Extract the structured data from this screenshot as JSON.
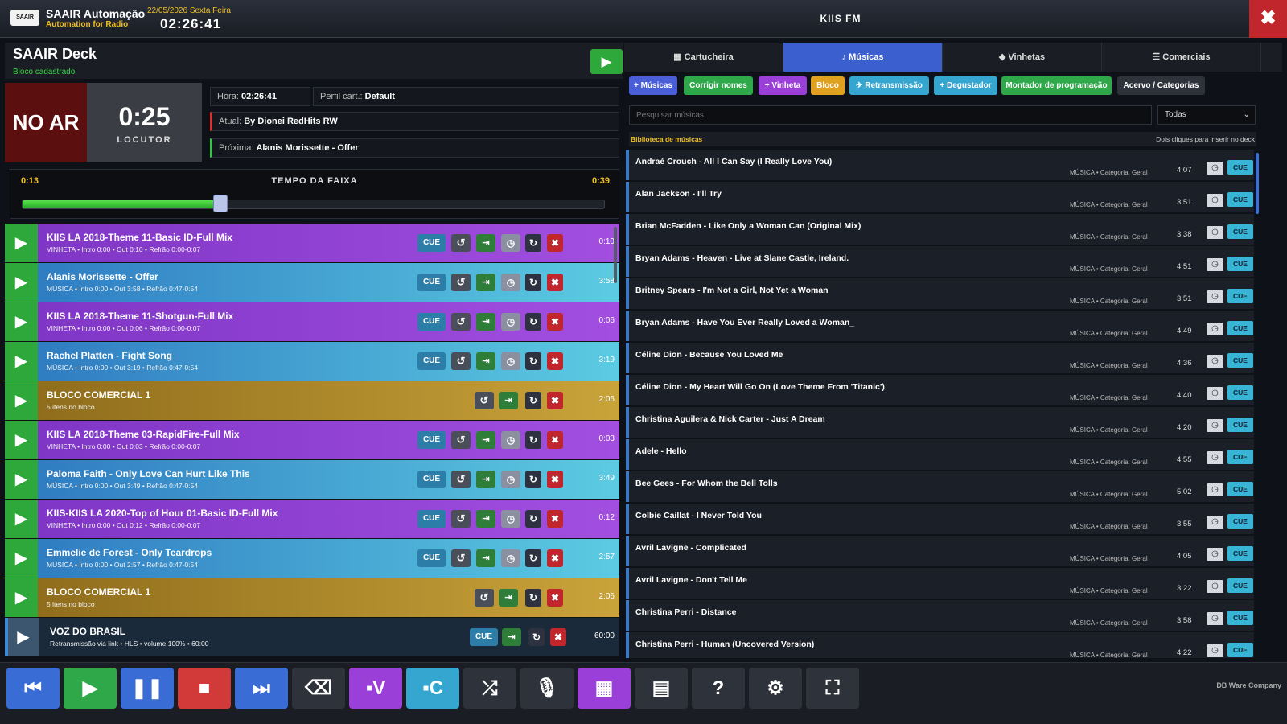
{
  "header": {
    "logo_text": "SAAIR",
    "app_name": "SAAIR Automação",
    "app_subtitle": "Automation for Radio",
    "date": "22/05/2026 Sexta Feira",
    "time": "02:26:41",
    "station": "KIIS FM",
    "close_icon": "✖"
  },
  "deck": {
    "title": "SAAIR Deck",
    "subtitle": "Bloco cadastrado",
    "play_icon": "▶",
    "onair": "NO AR",
    "countdown": "0:25",
    "countdown_label": "LOCUTOR",
    "hora_label": "Hora:",
    "hora": "02:26:41",
    "perfil_label": "Perfil cart.:",
    "perfil": "Default",
    "atual_label": "Atual:",
    "atual": "By Dionei RedHits RW",
    "proxima_label": "Próxima:",
    "proxima": "Alanis Morissette - Offer"
  },
  "track": {
    "elapsed": "0:13",
    "remaining": "0:39",
    "title": "TEMPO DA FAIXA",
    "progress": 0.34
  },
  "playlist": {
    "cue_label": "CUE",
    "icons": {
      "play": "▶",
      "replay": "↺",
      "next": "⇥",
      "clock": "◷",
      "repeat": "↻",
      "delete": "✖"
    },
    "rows": [
      {
        "type": "vinheta",
        "title": "KIIS LA 2018-Theme 11-Basic ID-Full Mix",
        "info": "VINHETA • Intro 0:00 • Out 0:10 • Refrão 0:00-0:07",
        "duration": "0:10"
      },
      {
        "type": "musica",
        "title": "Alanis Morissette - Offer",
        "info": "MÚSICA • Intro 0:00 • Out 3:58 • Refrão 0:47-0:54",
        "duration": "3:58"
      },
      {
        "type": "vinheta",
        "title": "KIIS LA 2018-Theme 11-Shotgun-Full Mix",
        "info": "VINHETA • Intro 0:00 • Out 0:06 • Refrão 0:00-0:07",
        "duration": "0:06"
      },
      {
        "type": "musica",
        "title": "Rachel Platten - Fight Song",
        "info": "MÚSICA • Intro 0:00 • Out 3:19 • Refrão 0:47-0:54",
        "duration": "3:19"
      },
      {
        "type": "bloco",
        "title": "BLOCO COMERCIAL 1",
        "info": "5 itens no bloco",
        "duration": "2:06"
      },
      {
        "type": "vinheta",
        "title": "KIIS LA 2018-Theme 03-RapidFire-Full Mix",
        "info": "VINHETA • Intro 0:00 • Out 0:03 • Refrão 0:00-0:07",
        "duration": "0:03"
      },
      {
        "type": "musica",
        "title": "Paloma Faith - Only Love Can Hurt Like This",
        "info": "MÚSICA • Intro 0:00 • Out 3:49 • Refrão 0:47-0:54",
        "duration": "3:49"
      },
      {
        "type": "vinheta",
        "title": "KIIS-KIIS LA 2020-Top of Hour 01-Basic ID-Full Mix",
        "info": "VINHETA • Intro 0:00 • Out 0:12 • Refrão 0:00-0:07",
        "duration": "0:12"
      },
      {
        "type": "musica",
        "title": "Emmelie de Forest - Only Teardrops",
        "info": "MÚSICA • Intro 0:00 • Out 2:57 • Refrão 0:47-0:54",
        "duration": "2:57"
      },
      {
        "type": "bloco",
        "title": "BLOCO COMERCIAL 1",
        "info": "5 itens no bloco",
        "duration": "2:06"
      },
      {
        "type": "voz",
        "title": "VOZ DO BRASIL",
        "info": "Retransmissão via link • HLS • volume 100% • 60:00",
        "duration": "60:00"
      }
    ]
  },
  "tabs": [
    {
      "label": "▦ Cartucheira",
      "active": false
    },
    {
      "label": "♪ Músicas",
      "active": true
    },
    {
      "label": "◆ Vinhetas",
      "active": false
    },
    {
      "label": "☰ Comerciais",
      "active": false
    }
  ],
  "library_buttons": [
    {
      "label": "+ Músicas",
      "color": "#4a5ed8"
    },
    {
      "label": "Corrigir nomes",
      "color": "#2fa84a"
    },
    {
      "label": "+ Vinheta",
      "color": "#9a3fd8"
    },
    {
      "label": "Bloco",
      "color": "#e0a020"
    },
    {
      "label": "✈ Retransmissão",
      "color": "#35a6d0"
    },
    {
      "label": "+ Degustador",
      "color": "#35a6d0"
    },
    {
      "label": "Montador de programação",
      "color": "#2fa84a"
    },
    {
      "label": "Acervo / Categorias",
      "color": "#2e323b"
    }
  ],
  "search": {
    "placeholder": "Pesquisar músicas",
    "filter": "Todas"
  },
  "library": {
    "title": "Biblioteca de músicas",
    "hint": "Dois cliques para inserir no deck",
    "meta": "MÚSICA • Categoria: Geral",
    "cue_label": "CUE",
    "clock_icon": "◷",
    "items": [
      {
        "name": "Andraé Crouch - All I Can Say (I Really Love You)",
        "duration": "4:07"
      },
      {
        "name": "Alan Jackson - I'll Try",
        "duration": "3:51"
      },
      {
        "name": "Brian McFadden - Like Only a Woman Can (Original Mix)",
        "duration": "3:38"
      },
      {
        "name": "Bryan Adams - Heaven - Live at Slane Castle, Ireland.",
        "duration": "4:51"
      },
      {
        "name": "Britney Spears - I'm Not a Girl, Not Yet a Woman",
        "duration": "3:51"
      },
      {
        "name": "Bryan Adams - Have You Ever Really Loved a Woman_",
        "duration": "4:49"
      },
      {
        "name": "Céline Dion - Because You Loved Me",
        "duration": "4:36"
      },
      {
        "name": "Céline Dion - My Heart Will Go On (Love Theme From 'Titanic')",
        "duration": "4:40"
      },
      {
        "name": "Christina Aguilera & Nick Carter - Just A Dream",
        "duration": "4:20"
      },
      {
        "name": "Adele - Hello",
        "duration": "4:55"
      },
      {
        "name": "Bee Gees - For Whom the Bell Tolls",
        "duration": "5:02"
      },
      {
        "name": "Colbie Caillat - I Never Told You",
        "duration": "3:55"
      },
      {
        "name": "Avril Lavigne - Complicated",
        "duration": "4:05"
      },
      {
        "name": "Avril Lavigne - Don't Tell Me",
        "duration": "3:22"
      },
      {
        "name": "Christina Perri - Distance",
        "duration": "3:58"
      },
      {
        "name": "Christina Perri - Human (Uncovered Version)",
        "duration": "4:22"
      }
    ]
  },
  "toolbar": {
    "buttons": [
      {
        "name": "previous-button",
        "icon": "⏮",
        "color": "#3a6cd6"
      },
      {
        "name": "play-button",
        "icon": "▶",
        "color": "#2fa84a"
      },
      {
        "name": "pause-button",
        "icon": "❚❚",
        "color": "#3a6cd6"
      },
      {
        "name": "stop-button",
        "icon": "■",
        "color": "#d23a3a"
      },
      {
        "name": "next-button",
        "icon": "⏭",
        "color": "#3a6cd6"
      },
      {
        "name": "eraser-button",
        "icon": "⌫",
        "color": "#2e323b"
      },
      {
        "name": "vinheta-button",
        "icon": "▪V",
        "color": "#9a3fd8"
      },
      {
        "name": "comercial-button",
        "icon": "▪C",
        "color": "#35a6d0"
      },
      {
        "name": "shuffle-button",
        "icon": "⤮",
        "color": "#2e323b"
      },
      {
        "name": "mic-button",
        "icon": "🎙",
        "color": "#2e323b"
      },
      {
        "name": "grid-button",
        "icon": "▦",
        "color": "#9a3fd8"
      },
      {
        "name": "building-button",
        "icon": "▤",
        "color": "#2e323b"
      },
      {
        "name": "help-button",
        "icon": "?",
        "color": "#2e323b"
      },
      {
        "name": "settings-button",
        "icon": "⚙",
        "color": "#2e323b"
      },
      {
        "name": "fullscreen-button",
        "icon": "⛶",
        "color": "#2e323b"
      }
    ],
    "company": "DB Ware Company"
  }
}
